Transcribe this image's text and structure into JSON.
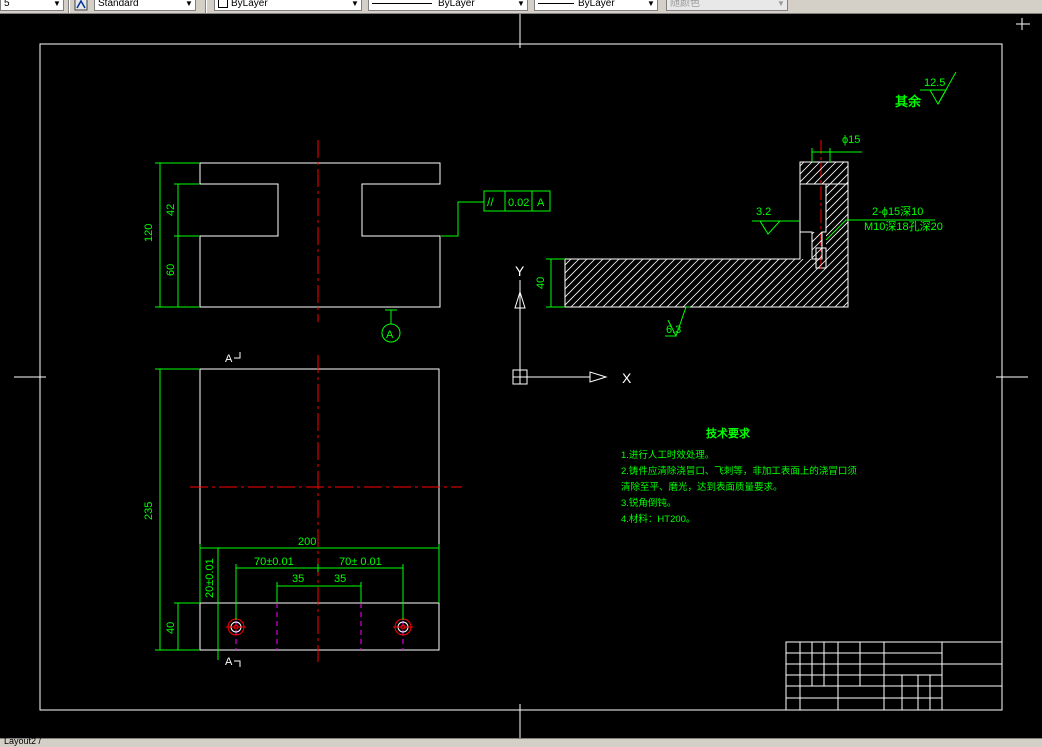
{
  "toolbar": {
    "scale_value": "5",
    "text_style": "Standard",
    "layer_color": "ByLayer",
    "linetype": "ByLayer",
    "lineweight": "ByLayer",
    "plot_style": "随颜色"
  },
  "status": {
    "layout_tab": "Layout2 /"
  },
  "drawing": {
    "roughness_other_label": "其余",
    "roughness_other_value": "12.5",
    "top_view_dim_height": "120",
    "top_view_dim_upper": "42",
    "top_view_dim_lower": "60",
    "tolerance_symbol": "//",
    "tolerance_value": "0.02",
    "tolerance_datum": "A",
    "datum_label": "A",
    "axis_x": "X",
    "axis_y": "Y",
    "section_dia": "ϕ15",
    "section_note1": "2-ϕ15深10",
    "section_note2": "M10深18孔深20",
    "section_rough1": "3.2",
    "section_rough2": "6.3",
    "section_dim_height": "40",
    "section_mark_top": "A",
    "section_mark_bottom": "A",
    "front_dim_height": "235",
    "front_dim_width": "200",
    "front_dim_left": "70±0.01",
    "front_dim_right": "70± 0.01",
    "front_dim_half_left": "35",
    "front_dim_half_right": "35",
    "front_dim_vert": "20±0.01",
    "front_dim_bottom": "40",
    "tech_title": "技术要求",
    "tech_items": [
      "1.进行人工时效处理。",
      "2.铸件应清除浇冒口、飞刺等，非加工表面上的浇冒口须",
      "清除至平、磨光，达到表面质量要求。",
      "3.锐角倒钝。",
      "4.材料：HT200。"
    ]
  },
  "colors": {
    "line_white": "#ffffff",
    "dim_green": "#00ff00",
    "center_red": "#ff0000",
    "hidden_magenta": "#ff00ff",
    "text_green": "#00ff00"
  }
}
